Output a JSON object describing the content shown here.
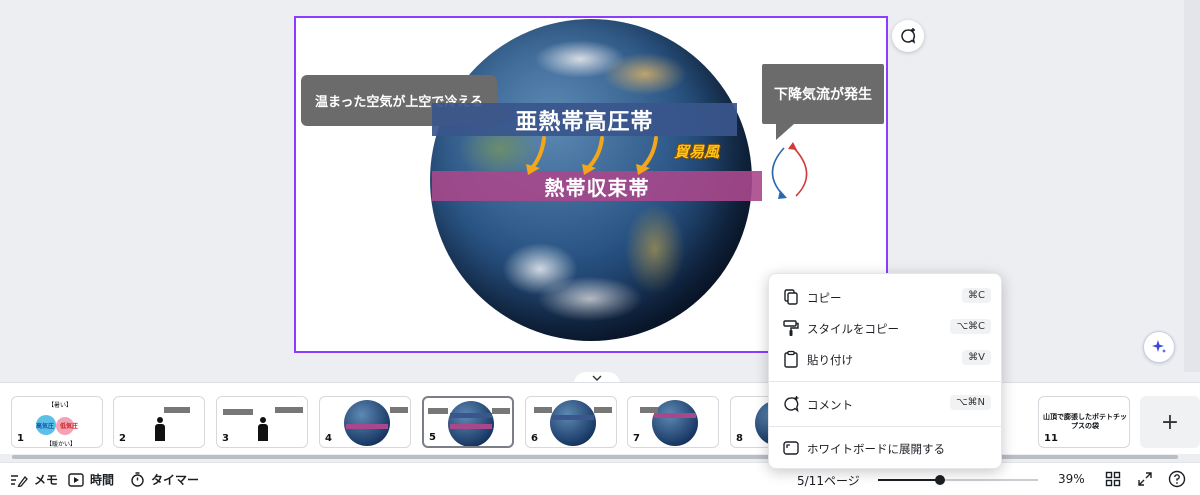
{
  "slide": {
    "bubble_left": "温まった空気が上空で冷える",
    "bubble_right": "下降気流が発生",
    "band_subtropical": "亜熱帯高圧帯",
    "band_itcz": "熱帯収束帯",
    "trade_wind": "貿易風"
  },
  "filmstrip": {
    "pages": [
      {
        "num": "1",
        "kind": "diagram"
      },
      {
        "num": "2",
        "kind": "person"
      },
      {
        "num": "3",
        "kind": "person"
      },
      {
        "num": "4",
        "kind": "globe"
      },
      {
        "num": "5",
        "kind": "globe",
        "selected": true
      },
      {
        "num": "6",
        "kind": "globe"
      },
      {
        "num": "7",
        "kind": "globe"
      },
      {
        "num": "8",
        "kind": "globe"
      },
      {
        "num": "11",
        "kind": "text",
        "text": "山頂で膨張したポテトチップスの袋"
      }
    ],
    "thumb1_labels": {
      "top": "【暑い】",
      "high": "高気圧",
      "low": "低気圧",
      "bottom": "【暖かい】"
    }
  },
  "bottom_bar": {
    "notes_label": "メモ",
    "time_label": "時間",
    "timer_label": "タイマー",
    "page_indicator": "5/11ページ",
    "zoom_value": "39%",
    "zoom_fraction": 0.39
  },
  "context_menu": {
    "items": [
      {
        "label": "コピー",
        "shortcut": "⌘C",
        "icon": "copy-icon"
      },
      {
        "label": "スタイルをコピー",
        "shortcut": "⌥⌘C",
        "icon": "paint-roller-icon"
      },
      {
        "label": "貼り付け",
        "shortcut": "⌘V",
        "icon": "clipboard-icon"
      },
      {
        "label": "コメント",
        "shortcut": "⌥⌘N",
        "icon": "comment-icon"
      },
      {
        "label": "ホワイトボードに展開する",
        "shortcut": "",
        "icon": "whiteboard-icon"
      }
    ]
  },
  "colors": {
    "accent": "#8b3dff",
    "subtropical_band": "#3a568c",
    "itcz_band": "#a8488c",
    "trade_wind": "#ffc21a"
  }
}
